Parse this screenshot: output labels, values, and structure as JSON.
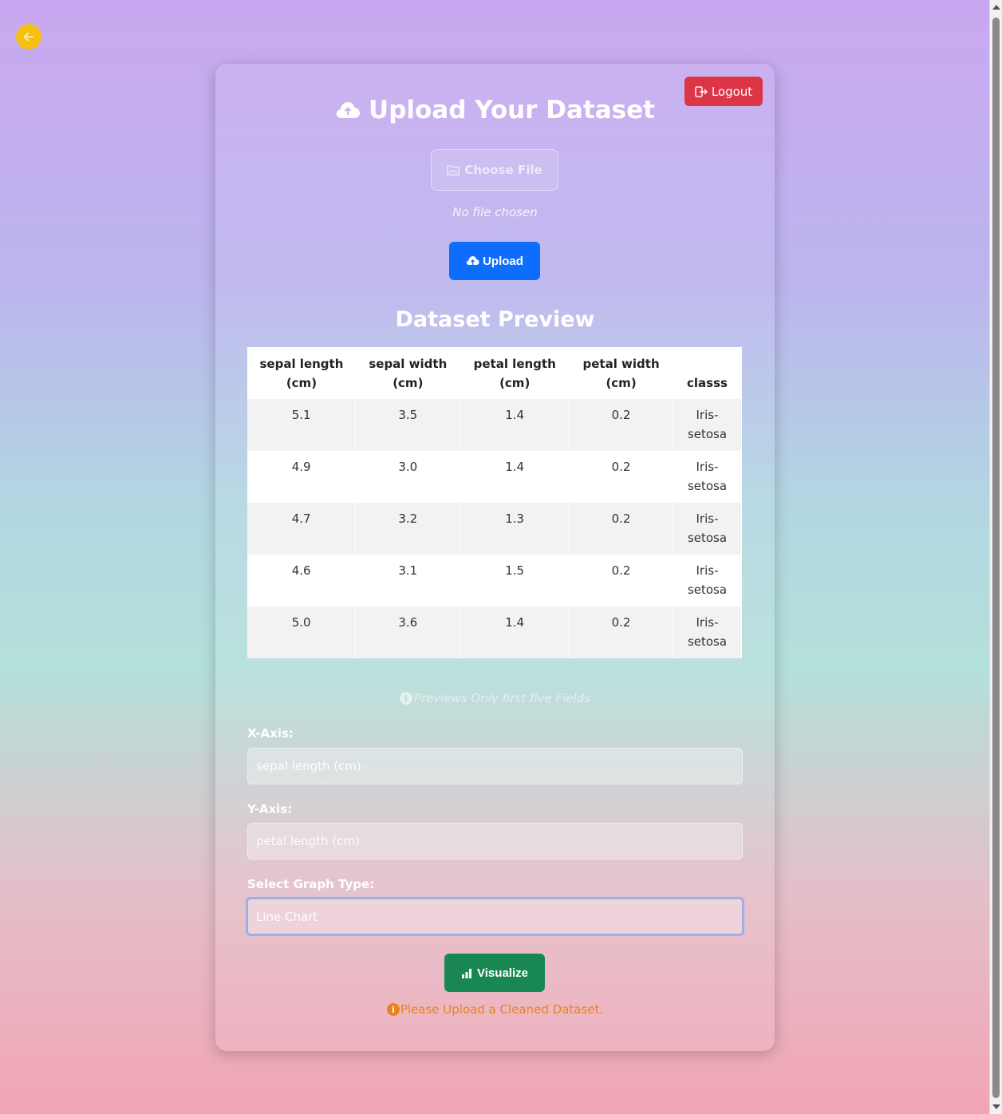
{
  "back": {
    "icon": "arrow-left-icon"
  },
  "header": {
    "title": "Upload Your Dataset",
    "title_icon": "cloud-upload-icon",
    "logout_label": "Logout",
    "logout_icon": "logout-icon"
  },
  "upload": {
    "choose_label": "Choose File",
    "choose_icon": "folder-icon",
    "file_status": "No file chosen",
    "upload_label": "Upload",
    "upload_icon": "cloud-upload-icon"
  },
  "preview": {
    "title": "Dataset Preview",
    "columns": [
      [
        "sepal length",
        "(cm)"
      ],
      [
        "sepal width",
        "(cm)"
      ],
      [
        "petal length",
        "(cm)"
      ],
      [
        "petal width",
        "(cm)"
      ],
      [
        "",
        "classs"
      ]
    ],
    "rows": [
      [
        "5.1",
        "3.5",
        "1.4",
        "0.2",
        "Iris-setosa"
      ],
      [
        "4.9",
        "3.0",
        "1.4",
        "0.2",
        "Iris-setosa"
      ],
      [
        "4.7",
        "3.2",
        "1.3",
        "0.2",
        "Iris-setosa"
      ],
      [
        "4.6",
        "3.1",
        "1.5",
        "0.2",
        "Iris-setosa"
      ],
      [
        "5.0",
        "3.6",
        "1.4",
        "0.2",
        "Iris-setosa"
      ]
    ],
    "note": "Previews Only first five Fields"
  },
  "form": {
    "x_label": "X-Axis:",
    "x_value": "sepal length (cm)",
    "y_label": "Y-Axis:",
    "y_value": "petal length (cm)",
    "graph_label": "Select Graph Type:",
    "graph_value": "Line Chart",
    "visualize_label": "Visualize",
    "visualize_icon": "bar-chart-icon",
    "warning": "Please Upload a Cleaned Dataset."
  },
  "colors": {
    "logout": "#dc3545",
    "upload": "#0d6efd",
    "visualize": "#198754",
    "warning": "#e8841e",
    "back": "#f6c00e"
  }
}
